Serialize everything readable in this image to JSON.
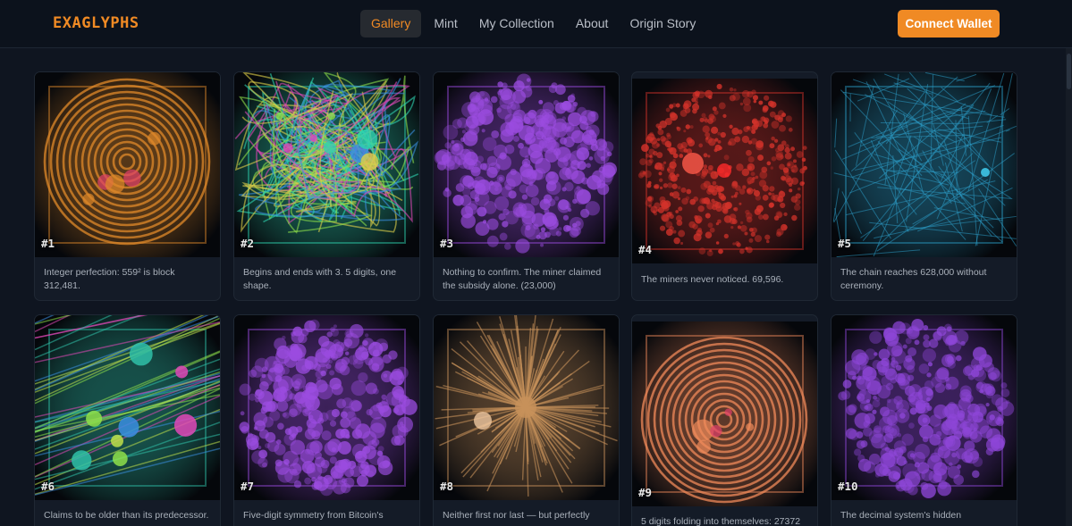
{
  "app": {
    "brand": "EXAGLYPHS"
  },
  "nav": {
    "items": [
      {
        "label": "Gallery",
        "active": true
      },
      {
        "label": "Mint"
      },
      {
        "label": "My Collection"
      },
      {
        "label": "About"
      },
      {
        "label": "Origin Story"
      }
    ]
  },
  "header": {
    "connect_label": "Connect Wallet"
  },
  "colors": {
    "accent": "#f08a24",
    "background": "#0f1520",
    "card": "#141b27"
  },
  "gallery": {
    "cards": [
      {
        "number": "#1",
        "caption": "Integer perfection: 559² is block 312,481.",
        "style": "rings",
        "hue": "#e0892a"
      },
      {
        "number": "#2",
        "caption": "Begins and ends with 3. 5 digits, one shape.",
        "style": "scribble",
        "hue": "#2fd3b0"
      },
      {
        "number": "#3",
        "caption": "Nothing to confirm. The miner claimed the subsidy alone. (23,000)",
        "style": "bubbles",
        "hue": "#9b4ce0"
      },
      {
        "number": "#4",
        "caption": "The miners never noticed. 69,596.",
        "style": "dots",
        "hue": "#d2322a"
      },
      {
        "number": "#5",
        "caption": "The chain reaches 628,000 without ceremony.",
        "style": "lines",
        "hue": "#2b9bc4"
      },
      {
        "number": "#6",
        "caption": "Claims to be older than its predecessor.",
        "style": "streaks",
        "hue": "#2fc0a8"
      },
      {
        "number": "#7",
        "caption": "Five-digit symmetry from Bitcoin's",
        "style": "bubbles",
        "hue": "#9b4ce0"
      },
      {
        "number": "#8",
        "caption": "Neither first nor last — but perfectly",
        "style": "burst",
        "hue": "#c7915a"
      },
      {
        "number": "#9",
        "caption": "5 digits folding into themselves: 27372",
        "style": "rings2",
        "hue": "#f08a5a"
      },
      {
        "number": "#10",
        "caption": "The decimal system's hidden",
        "style": "bubbles",
        "hue": "#8e46d8"
      }
    ]
  }
}
